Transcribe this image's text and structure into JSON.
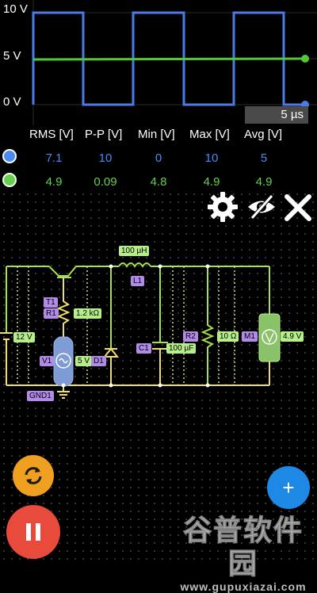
{
  "scope": {
    "y_labels": [
      "10 V",
      "5 V",
      "0 V"
    ],
    "timebase": "5 µs",
    "series": [
      {
        "color": "#4a7ce8",
        "shape": "square wave",
        "min_v": 0,
        "max_v": 10
      },
      {
        "color": "#54c832",
        "shape": "flat line",
        "value_v": 4.9
      }
    ]
  },
  "measurements": {
    "headers": [
      "RMS [V]",
      "P-P [V]",
      "Min [V]",
      "Max [V]",
      "Avg [V]"
    ],
    "rows": [
      {
        "color": "#4a8af4",
        "values": [
          "7.1",
          "10",
          "0",
          "10",
          "5"
        ]
      },
      {
        "color": "#66d04e",
        "values": [
          "4.9",
          "0.09",
          "4.8",
          "4.9",
          "4.9"
        ]
      }
    ]
  },
  "toolbar": {
    "icons": [
      "gear-icon",
      "eye-off-icon",
      "close-icon"
    ]
  },
  "circuit": {
    "labels": {
      "l1_value": "100 µH",
      "l1_name": "L1",
      "t1_name": "T1",
      "r1_name": "R1",
      "r1_value": "1.2 kΩ",
      "src12_value": "12 V",
      "v1_name": "V1",
      "v1_value": "5 V",
      "d1_name": "D1",
      "c1_name": "C1",
      "c1_value": "100 µF",
      "r2_name": "R2",
      "r2_value": "10 Ω",
      "m1_name": "M1",
      "m1_value": "4.9 V",
      "gnd_name": "GND1"
    }
  },
  "buttons": {
    "refresh": {
      "icon": "refresh-icon",
      "color": "#f0a020"
    },
    "pause": {
      "icon": "pause-icon",
      "color": "#e84a3c"
    },
    "add": {
      "icon": "plus-icon",
      "label": "+",
      "color": "#1e88e5"
    }
  },
  "watermark": {
    "text": "谷普软件园",
    "url": "www.gupuxiazai.com"
  }
}
